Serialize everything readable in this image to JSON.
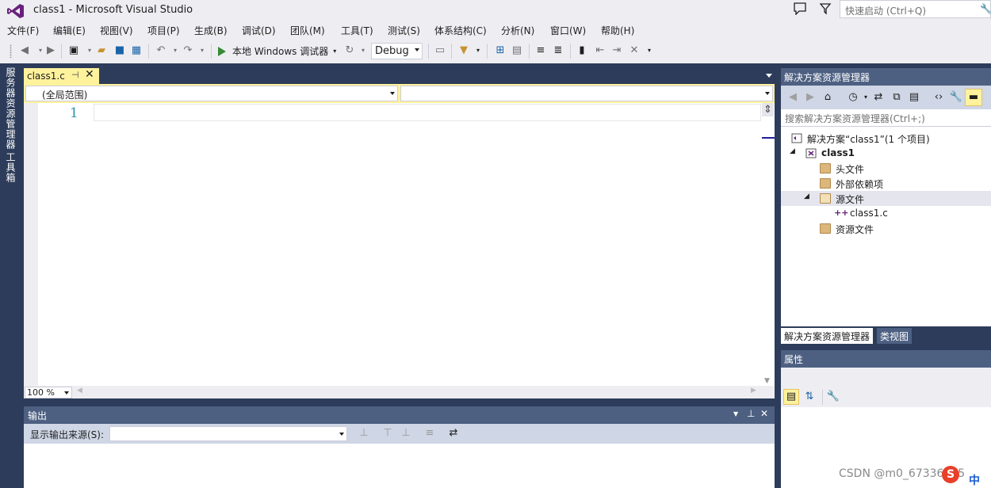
{
  "window": {
    "title": "class1 - Microsoft Visual Studio",
    "quick_launch_placeholder": "快速启动 (Ctrl+Q)"
  },
  "menu": [
    "文件(F)",
    "编辑(E)",
    "视图(V)",
    "项目(P)",
    "生成(B)",
    "调试(D)",
    "团队(M)",
    "工具(T)",
    "测试(S)",
    "体系结构(C)",
    "分析(N)",
    "窗口(W)",
    "帮助(H)"
  ],
  "toolbar": {
    "run_label": "本地 Windows 调试器",
    "config": "Debug"
  },
  "left_tabs": [
    "服务器资源管理器",
    "工具箱"
  ],
  "editor": {
    "tab_label": "class1.c",
    "scope": "(全局范围)",
    "line_number": "1",
    "zoom": "100 %"
  },
  "output": {
    "title": "输出",
    "source_label": "显示输出来源(S):"
  },
  "solution_explorer": {
    "title": "解决方案资源管理器",
    "search_placeholder": "搜索解决方案资源管理器(Ctrl+;)",
    "tree": [
      {
        "label": "解决方案“class1”(1 个项目)",
        "icon": "solution-icon"
      },
      {
        "label": "class1",
        "icon": "project-icon"
      },
      {
        "label": "头文件",
        "icon": "folder-icon"
      },
      {
        "label": "外部依赖项",
        "icon": "external-deps-icon"
      },
      {
        "label": "源文件",
        "icon": "folder-icon"
      },
      {
        "label": "class1.c",
        "icon": "c-file-icon"
      },
      {
        "label": "资源文件",
        "icon": "folder-icon"
      }
    ],
    "tabs": [
      "解决方案资源管理器",
      "类视图"
    ]
  },
  "properties": {
    "title": "属性"
  },
  "watermark": "CSDN @m0_67336575",
  "ime": "中",
  "colors": {
    "frame": "#2d3c5a",
    "panel_header": "#4d6082",
    "active_doc_tab": "#fff29d",
    "line_number": "#2b91af"
  }
}
